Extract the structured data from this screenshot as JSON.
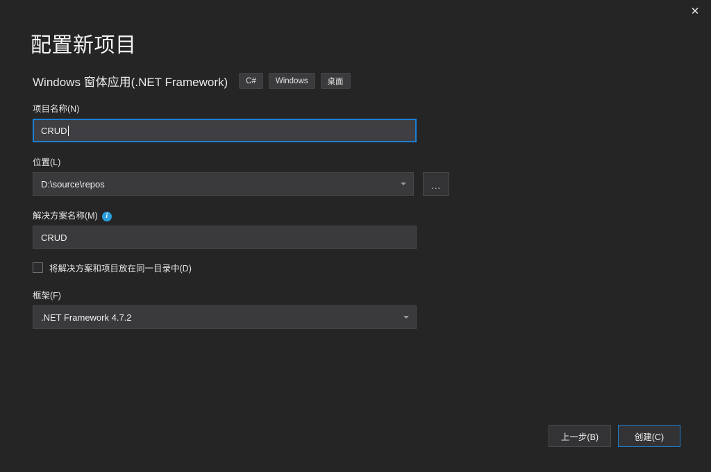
{
  "window": {
    "close_label": "✕"
  },
  "header": {
    "title": "配置新项目",
    "subtitle": "Windows 窗体应用(.NET Framework)",
    "tags": [
      "C#",
      "Windows",
      "桌面"
    ]
  },
  "form": {
    "project_name": {
      "label": "项目名称(N)",
      "value": "CRUD",
      "placeholder": ""
    },
    "location": {
      "label": "位置(L)",
      "value": "D:\\source\\repos",
      "placeholder": "",
      "browse_label": "..."
    },
    "solution_name": {
      "label": "解决方案名称(M)",
      "value": "CRUD",
      "placeholder": "",
      "info_glyph": "i"
    },
    "same_directory": {
      "label": "将解决方案和项目放在同一目录中(D)",
      "checked": false
    },
    "framework": {
      "label": "框架(F)",
      "value": ".NET Framework 4.7.2"
    }
  },
  "footer": {
    "back_label": "上一步(B)",
    "create_label": "创建(C)"
  },
  "colors": {
    "background": "#252526",
    "input_background": "#3a3a3c",
    "accent": "#1b7fd4",
    "info_blue": "#2a9ddb",
    "text": "#f1f1f1"
  }
}
